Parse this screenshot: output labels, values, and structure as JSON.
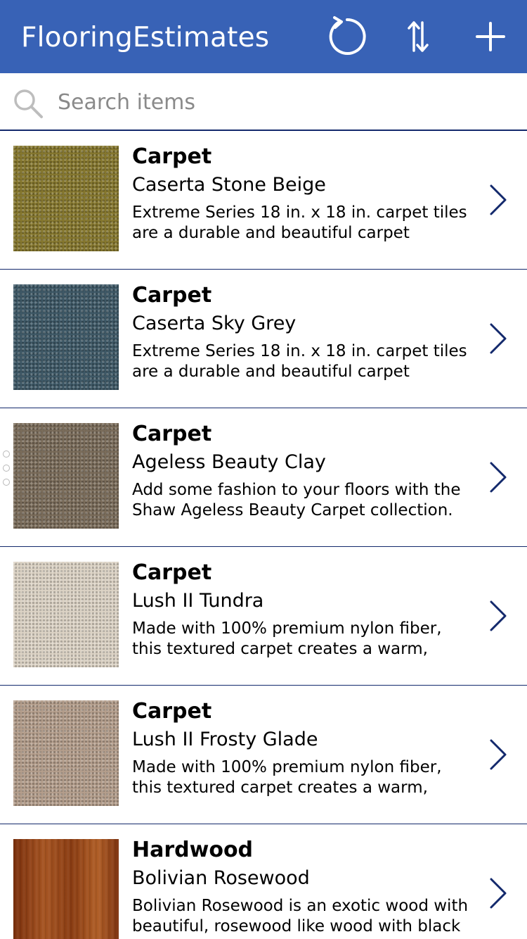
{
  "header": {
    "title": "FlooringEstimates",
    "refresh_icon": "refresh-icon",
    "sort_icon": "sort-icon",
    "add_icon": "add-icon",
    "bg_color": "#3862b6"
  },
  "search": {
    "placeholder": "Search items",
    "value": "",
    "icon": "search-icon"
  },
  "items": [
    {
      "category": "Carpet",
      "name": "Caserta Stone Beige",
      "description": "Extreme Series 18 in. x 18 in. carpet tiles are a durable and beautiful carpet solution specially engineered for both",
      "swatch": "#85772e"
    },
    {
      "category": "Carpet",
      "name": "Caserta Sky Grey",
      "description": "Extreme Series 18 in. x 18 in. carpet tiles are a durable and beautiful carpet solution specially engineered for both",
      "swatch": "#3e5866"
    },
    {
      "category": "Carpet",
      "name": "Ageless Beauty Clay",
      "description": "Add some fashion to your floors with the Shaw Ageless Beauty Carpet collection.",
      "swatch": "#7a6c5a"
    },
    {
      "category": "Carpet",
      "name": "Lush II Tundra",
      "description": "Made with 100% premium nylon fiber, this textured carpet creates a warm, casual atmosphere that invites you to",
      "swatch": "#dcd3c5"
    },
    {
      "category": "Carpet",
      "name": "Lush II Frosty Glade",
      "description": "Made with 100% premium nylon fiber, this textured carpet creates a warm, casual atmosphere that invites you to",
      "swatch": "#b49e8c"
    },
    {
      "category": "Hardwood",
      "name": "Bolivian Rosewood",
      "description": "Bolivian Rosewood is an exotic wood with beautiful, rosewood like wood with black",
      "swatch": "#8d3e14"
    }
  ],
  "colors": {
    "accent": "#3862b6",
    "divider": "#13296c",
    "chevron": "#13296c"
  }
}
